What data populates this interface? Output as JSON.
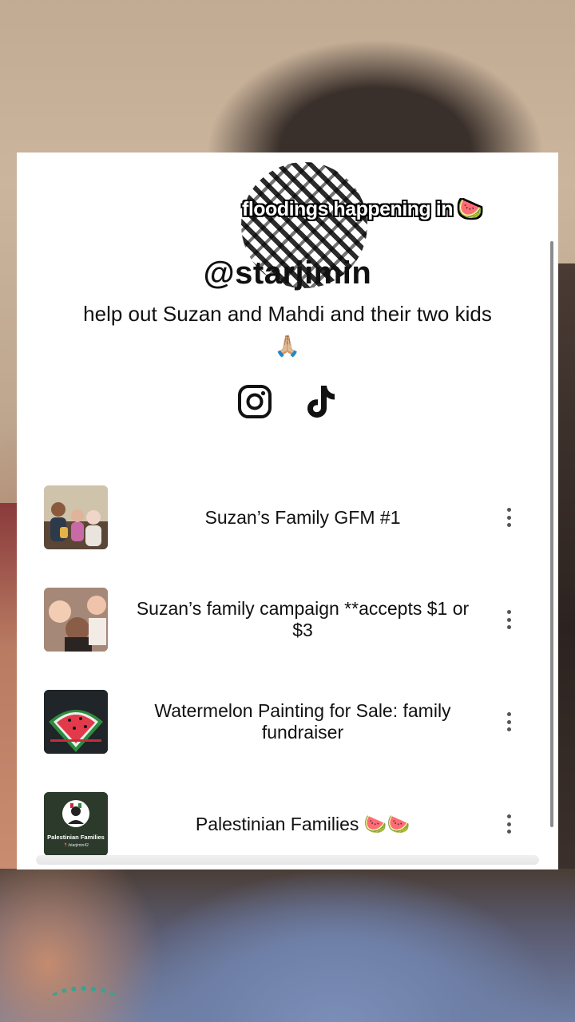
{
  "overlay": {
    "caption": "floodings happening in 🍉"
  },
  "profile": {
    "handle": "@starjimin",
    "bio": "help out Suzan and Mahdi and their two kids 🙏🏼",
    "socials": [
      "instagram-icon",
      "tiktok-icon"
    ]
  },
  "links": [
    {
      "title": "Suzan’s Family GFM #1",
      "thumb": "family-photo"
    },
    {
      "title": "Suzan’s family campaign **accepts $1 or $3",
      "thumb": "family-selfie"
    },
    {
      "title": "Watermelon Painting for Sale: family fundraiser",
      "thumb": "watermelon-painting"
    },
    {
      "title": "Palestinian Families 🍉🍉",
      "thumb": "palestinian-families-logo",
      "thumb_text": "Palestinian Families",
      "thumb_subtext": "📍/starjimin42"
    }
  ],
  "colors": {
    "card_bg": "#ffffff",
    "text": "#111111",
    "kebab": "#555555"
  }
}
